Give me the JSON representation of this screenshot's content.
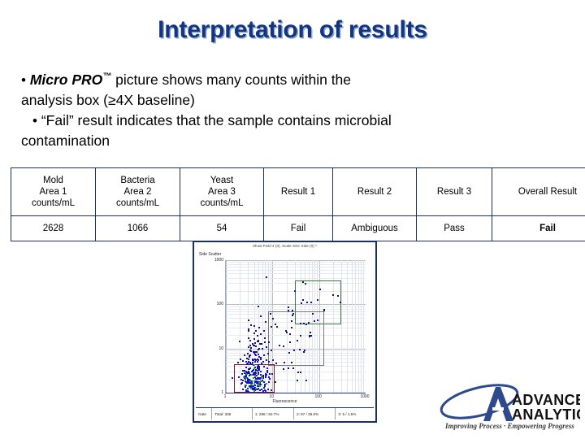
{
  "slide": {
    "title": "Interpretation of results"
  },
  "bullets": [
    {
      "dot": "•",
      "pre_em": "Micro PRO",
      "tm": "™",
      "rest": " picture shows many counts within the",
      "cont": "analysis box (≥4X baseline)"
    },
    {
      "dot": "•",
      "text": "“Fail” result indicates that the sample contains microbial",
      "cont": "contamination"
    }
  ],
  "table": {
    "headers": [
      "Mold\nArea 1\ncounts/mL",
      "Bacteria\nArea 2\ncounts/mL",
      "Yeast\nArea 3\ncounts/mL",
      "Result 1",
      "Result 2",
      "Result 3",
      "Overall Result"
    ],
    "row": [
      "2628",
      "1066",
      "54",
      "Fail",
      "Ambiguous",
      "Pass",
      "Fail"
    ]
  },
  "scatter": {
    "title": "Show Field 4 (0), Scale SSC Side (0) *",
    "ylabel": "Side Scatter",
    "xlabel": "Fluorescence",
    "yticks": [
      "1000",
      "100",
      "10",
      "1"
    ],
    "xticks": [
      "1",
      "10",
      "100",
      "1000"
    ],
    "status": [
      "Gate",
      "Total: 335",
      "1: 286 / 82.7%",
      "2: 97 / 28.6%",
      "3: 5 / 1.5%"
    ],
    "gates": [
      {
        "name": "gate-green",
        "color": "#3c7a3c"
      },
      {
        "name": "gate-gray",
        "color": "#7a7a82"
      },
      {
        "name": "gate-red",
        "color": "#7a1f1f"
      }
    ]
  },
  "chart_data": {
    "type": "scatter",
    "title": "Show Field 4 (0), Scale SSC Side (0) *",
    "xlabel": "Fluorescence",
    "ylabel": "Side Scatter",
    "xscale": "log",
    "yscale": "log",
    "xlim": [
      1,
      1000
    ],
    "ylim": [
      1,
      1000
    ],
    "xticks": [
      1,
      10,
      100,
      1000
    ],
    "yticks": [
      1,
      10,
      100,
      1000
    ],
    "grid": true,
    "legend": "none",
    "series": [
      {
        "name": "events",
        "color": "#1414cc",
        "note": "dense cluster at low fluorescence (x 2-12) and low side scatter (y 1-20); sparse scattered events up to x 300, y 900"
      },
      {
        "name": "events-green",
        "color": "#22aa33",
        "note": "subset of cluster points rendered green within gate 3"
      }
    ],
    "gates": [
      {
        "label": "green-gate",
        "x_range": [
          30,
          300
        ],
        "y_range": [
          35,
          350
        ],
        "color": "#3c7a3c"
      },
      {
        "label": "gray-gate",
        "x_range": [
          8,
          130
        ],
        "y_range": [
          4,
          70
        ],
        "color": "#7a7a82"
      },
      {
        "label": "red-gate",
        "x_range": [
          1.5,
          11
        ],
        "y_range": [
          1,
          4.5
        ],
        "color": "#7a1f1f"
      }
    ],
    "counts": {
      "total": 335,
      "gate1": 286,
      "gate1_pct": 82.7,
      "gate2": 97,
      "gate2_pct": 28.6,
      "gate3": 5,
      "gate3_pct": 1.5
    }
  },
  "logo": {
    "line1": "ADVANCED",
    "line2": "ANALYTICAL",
    "tagline": "Improving Process · Empowering Progress",
    "color_text": "#1a1a1a",
    "color_mark": "#2e4a8c"
  }
}
